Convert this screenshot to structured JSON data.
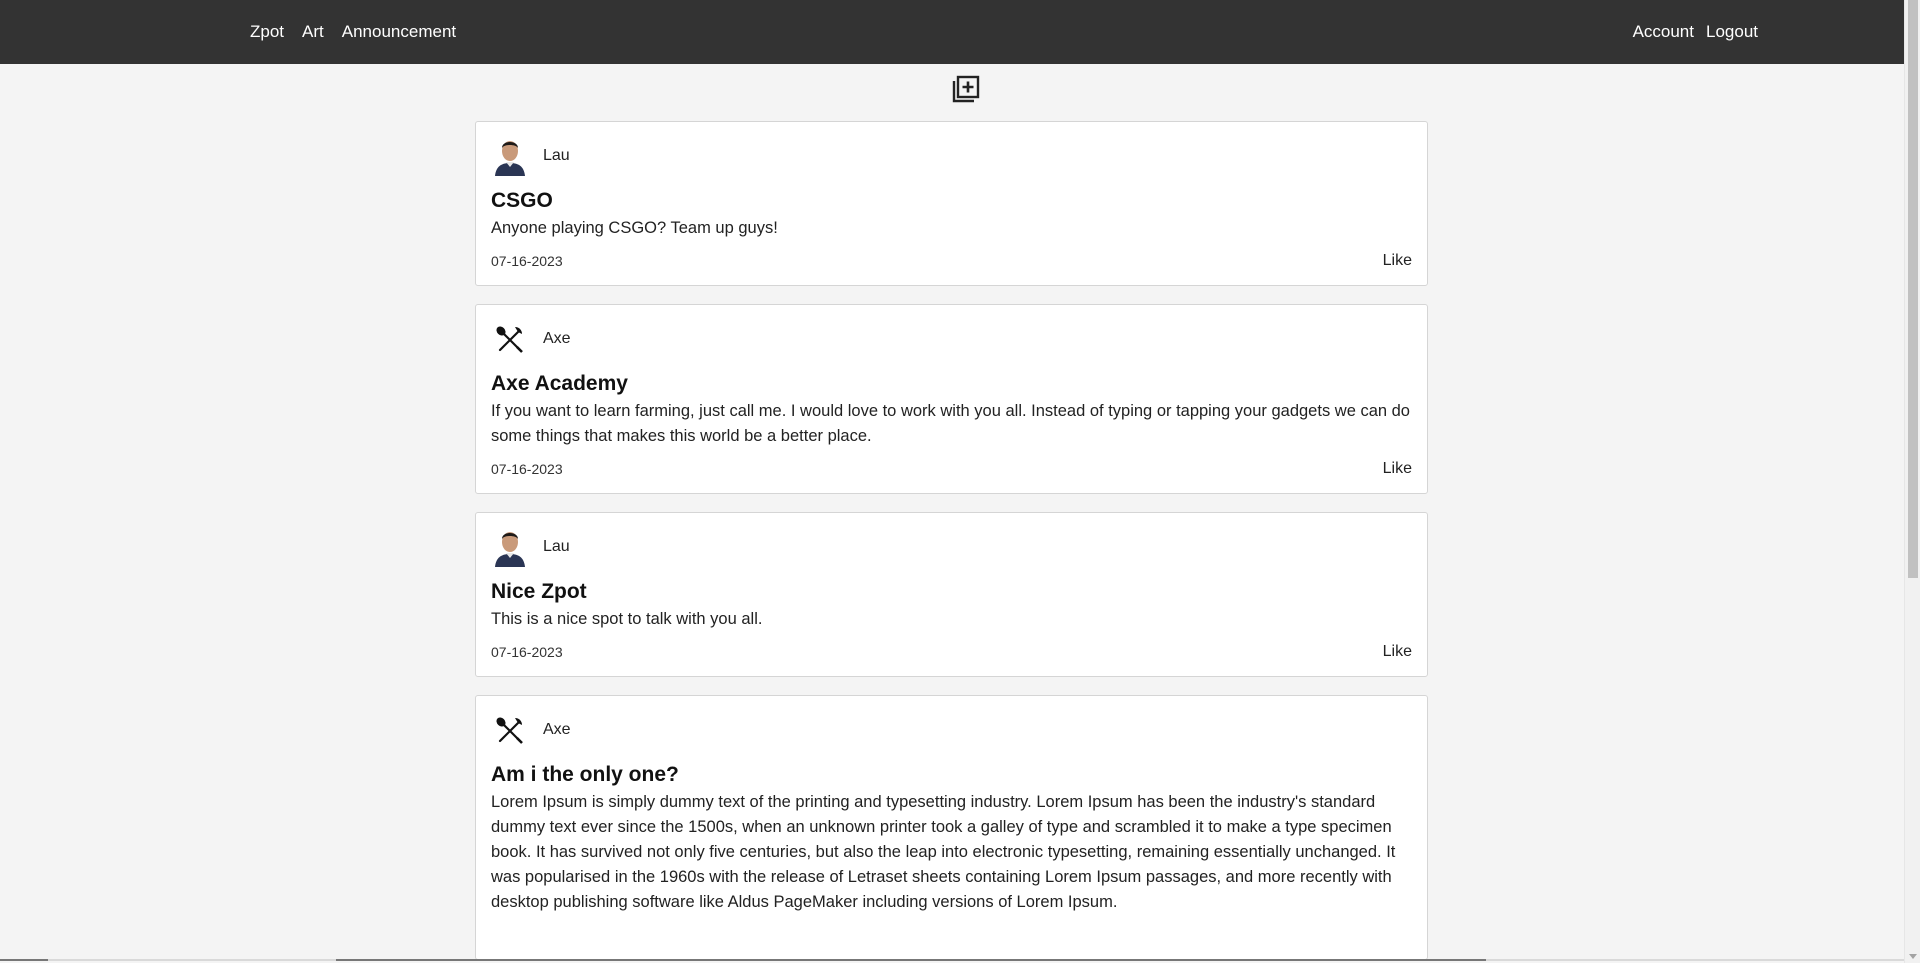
{
  "nav": {
    "left": [
      "Zpot",
      "Art",
      "Announcement"
    ],
    "right": [
      "Account",
      "Logout"
    ]
  },
  "toolbar": {
    "add_icon": "add-post-icon"
  },
  "posts": [
    {
      "author": "Lau",
      "avatar": "person-photo",
      "title": "CSGO",
      "body": "Anyone playing CSGO? Team up guys!",
      "date": "07-16-2023",
      "like_label": "Like"
    },
    {
      "author": "Axe",
      "avatar": "axe-shovel-icon",
      "title": "Axe Academy",
      "body": "If you want to learn farming, just call me. I would love to work with you all. Instead of typing or tapping your gadgets we can do some things that makes this world be a better place.",
      "date": "07-16-2023",
      "like_label": "Like"
    },
    {
      "author": "Lau",
      "avatar": "person-photo",
      "title": "Nice Zpot",
      "body": "This is a nice spot to talk with you all.",
      "date": "07-16-2023",
      "like_label": "Like"
    },
    {
      "author": "Axe",
      "avatar": "axe-shovel-icon",
      "title": "Am i the only one?",
      "body": "Lorem Ipsum is simply dummy text of the printing and typesetting industry. Lorem Ipsum has been the industry's standard dummy text ever since the 1500s, when an unknown printer took a galley of type and scrambled it to make a type specimen book. It has survived not only five centuries, but also the leap into electronic typesetting, remaining essentially unchanged. It was popularised in the 1960s with the release of Letraset sheets containing Lorem Ipsum passages, and more recently with desktop publishing software like Aldus PageMaker including versions of Lorem Ipsum.",
      "date": "",
      "like_label": ""
    }
  ]
}
